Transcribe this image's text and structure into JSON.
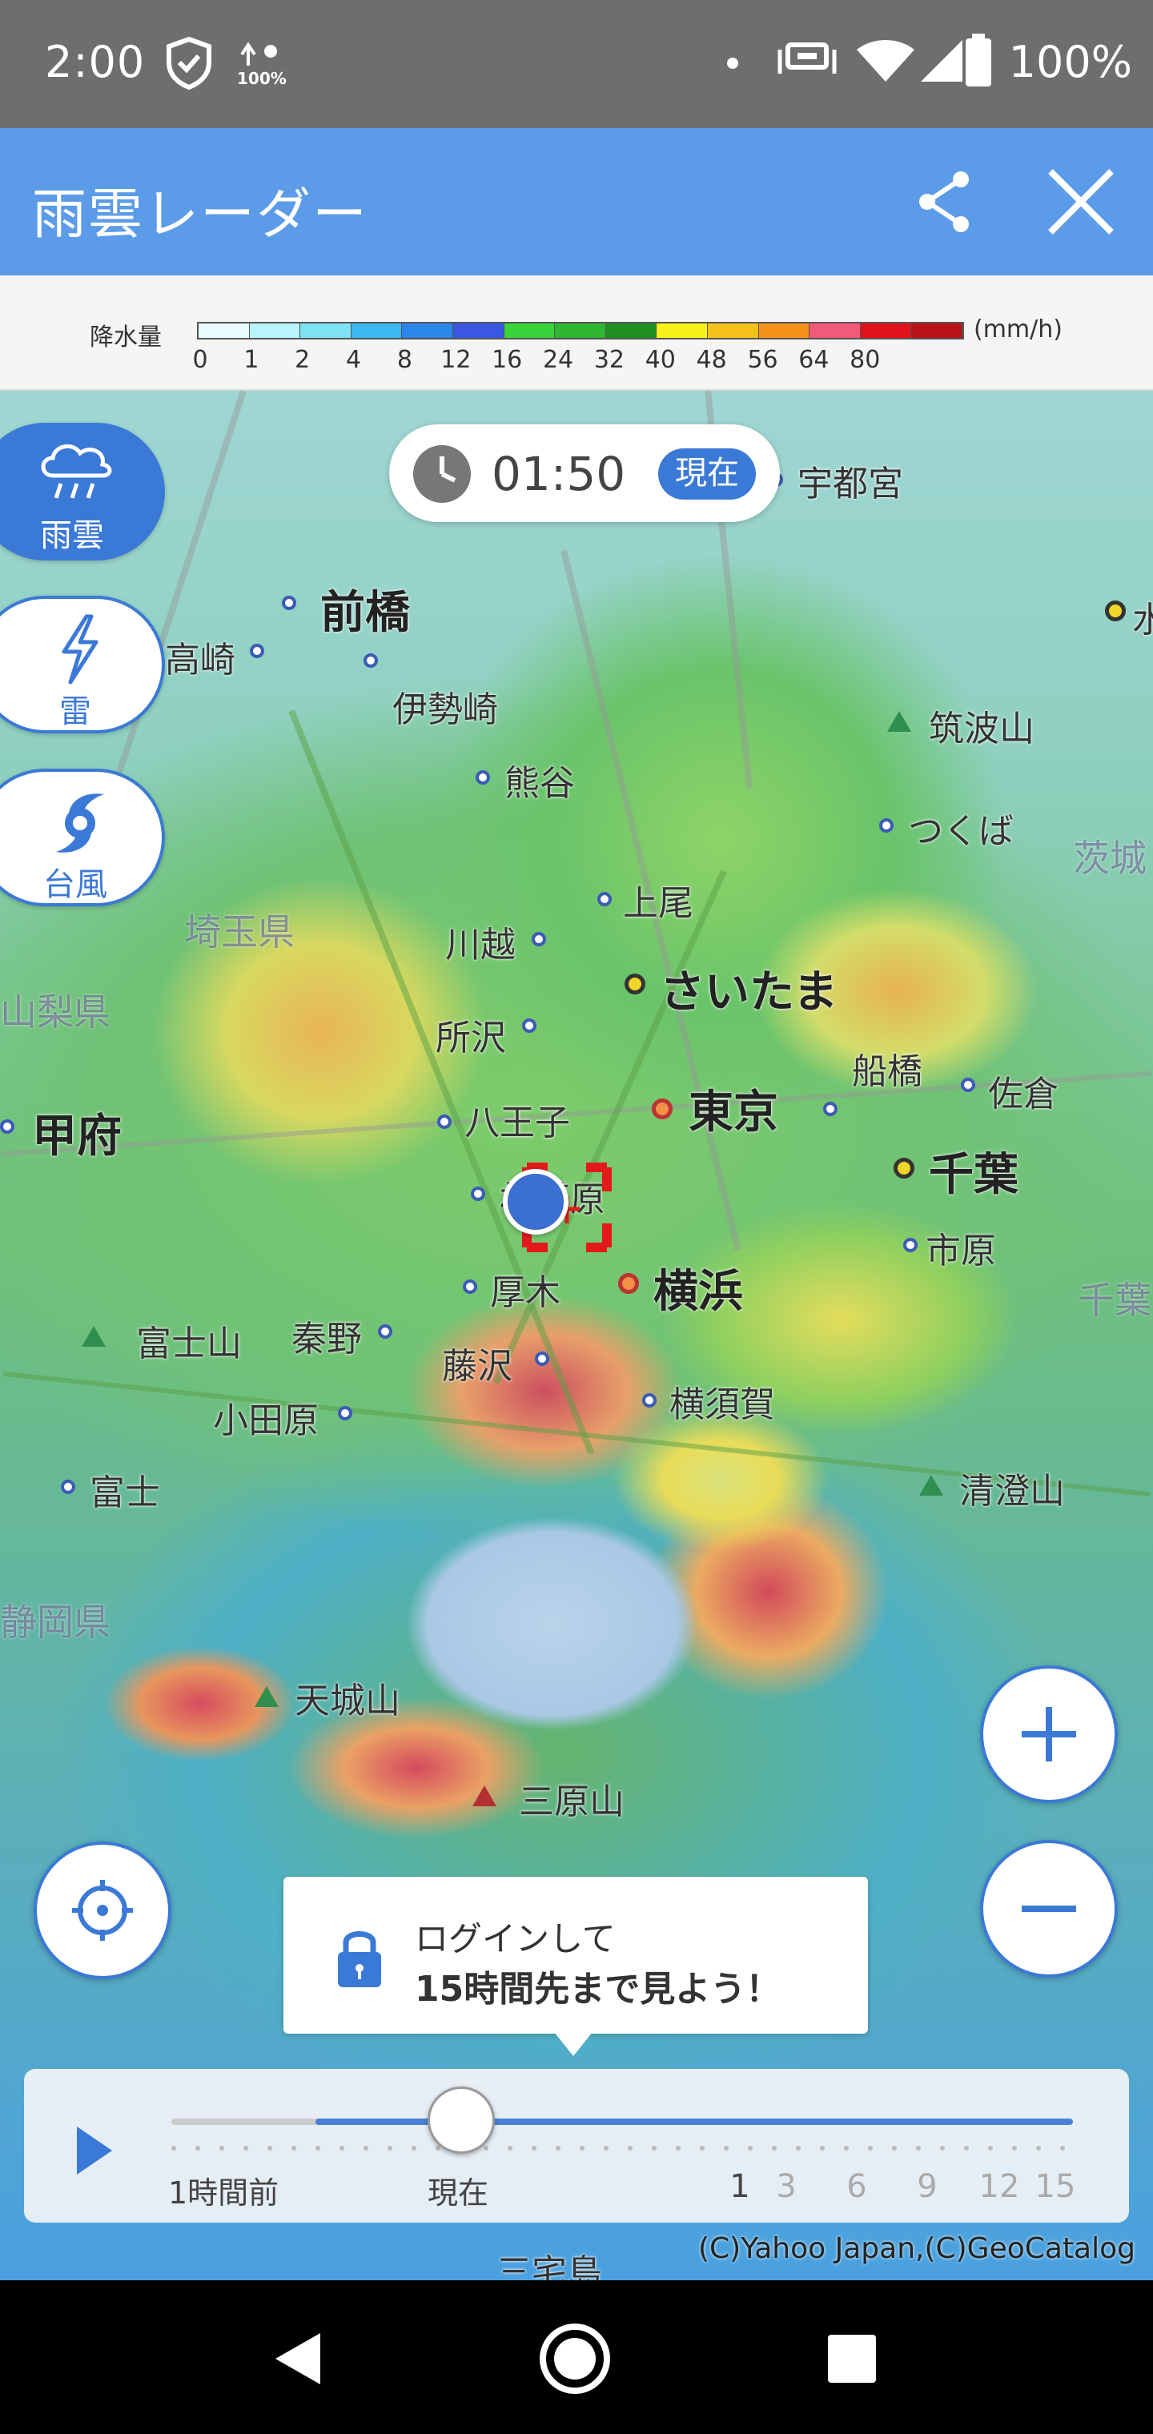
{
  "status_bar": {
    "time": "2:00",
    "battery": "100%",
    "small_badge": "100%"
  },
  "app_bar": {
    "title": "雨雲レーダー",
    "share_icon": "share-icon",
    "close_icon": "close-icon"
  },
  "legend": {
    "label": "降水量",
    "unit": "(mm/h)",
    "ticks": [
      "0",
      "1",
      "2",
      "4",
      "8",
      "12",
      "16",
      "24",
      "32",
      "40",
      "48",
      "56",
      "64",
      "80"
    ],
    "colors": [
      "#e9fbff",
      "#b9f3fb",
      "#7be3f3",
      "#3ab8f0",
      "#2a86ea",
      "#3a57e4",
      "#38d43a",
      "#2eb62e",
      "#1f8f1f",
      "#f6f21a",
      "#f5c21a",
      "#f5921a",
      "#f25a7a",
      "#e0121a",
      "#b8121a"
    ]
  },
  "time_chip": {
    "time": "01:50",
    "now_label": "現在"
  },
  "side_buttons": [
    {
      "label": "雨雲",
      "icon": "rain-cloud-icon",
      "active": true
    },
    {
      "label": "雷",
      "icon": "lightning-icon",
      "active": false
    },
    {
      "label": "台風",
      "icon": "typhoon-icon",
      "active": false
    }
  ],
  "map_labels": {
    "utsunomiya": "宇都宮",
    "maebashi": "前橋",
    "takasaki": "高崎",
    "isesaki": "伊勢崎",
    "kumagaya": "熊谷",
    "tsukubasan": "筑波山",
    "tsukuba": "つくば",
    "ibaraki": "茨城",
    "ageo": "上尾",
    "saitama_pref": "埼玉県",
    "kawagoe": "川越",
    "saitama": "さいたま",
    "yamanashi_pref": "山梨県",
    "tokorozawa": "所沢",
    "funabashi": "船橋",
    "sakura": "佐倉",
    "kofu": "甲府",
    "hachioji": "八王子",
    "tokyo": "東京",
    "chiba": "千葉",
    "sagamihara": "相模原",
    "ichihara": "市原",
    "chiba_pref": "千葉",
    "atsugi": "厚木",
    "yokohama": "横浜",
    "fujisan": "富士山",
    "hadano": "秦野",
    "fujisawa": "藤沢",
    "yokosuka": "横須賀",
    "odawara": "小田原",
    "fuji": "富士",
    "kiyosumiyama": "清澄山",
    "amagisan": "天城山",
    "miharayama": "三原山",
    "miyakejima": "三宅島",
    "shizuoka_pref": "静岡県",
    "mito": "水戸"
  },
  "tooltip": {
    "line1": "ログインして",
    "line2": "15時間先まで見よう！"
  },
  "timeline": {
    "start_label": "1時間前",
    "now_label": "現在",
    "hours": [
      "1",
      "3",
      "6",
      "9",
      "12",
      "15"
    ],
    "active_hour": "1"
  },
  "copyright": "(C)Yahoo Japan,(C)GeoCatalog"
}
